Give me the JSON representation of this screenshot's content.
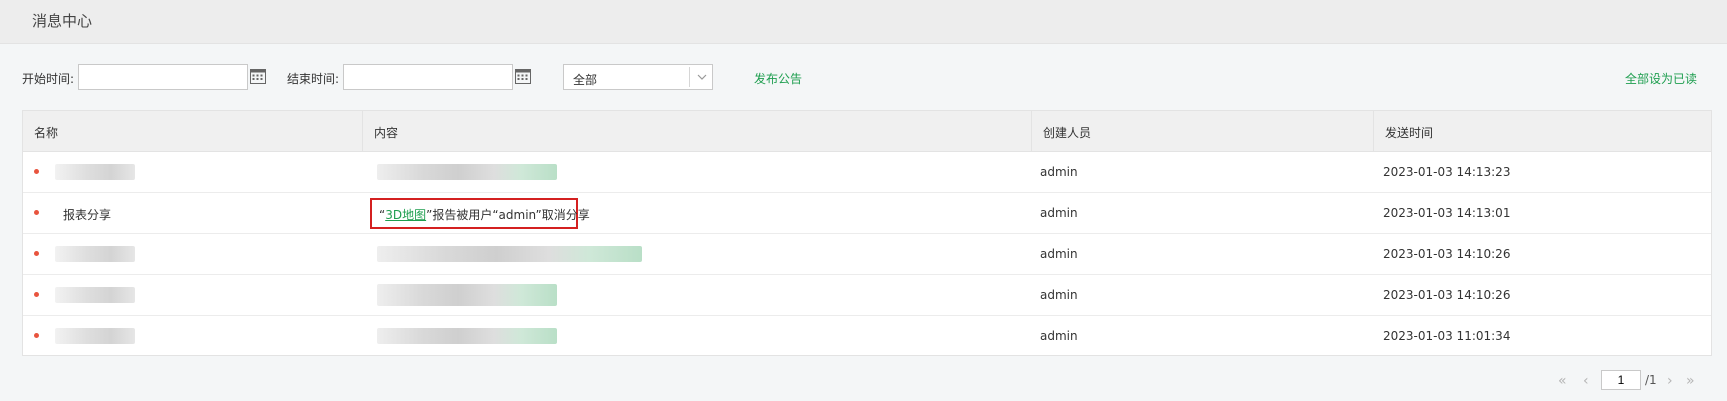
{
  "header": {
    "title": "消息中心"
  },
  "filters": {
    "start_label": "开始时间:",
    "end_label": "结束时间:",
    "start_value": "",
    "end_value": "",
    "type_select": "全部",
    "publish_label": "发布公告",
    "mark_all_read_label": "全部设为已读"
  },
  "table": {
    "columns": [
      "名称",
      "内容",
      "创建人员",
      "发送时间"
    ],
    "rows": [
      {
        "name": "",
        "content": "",
        "creator": "admin",
        "time": "2023-01-03 14:13:23"
      },
      {
        "name": "报表分享",
        "content_prefix": "“",
        "content_link": "3D地图",
        "content_suffix": "”报告被用户“admin”取消分享",
        "creator": "admin",
        "time": "2023-01-03 14:13:01"
      },
      {
        "name": "",
        "content": "",
        "creator": "admin",
        "time": "2023-01-03 14:10:26"
      },
      {
        "name": "",
        "content": "",
        "creator": "admin",
        "time": "2023-01-03 14:10:26"
      },
      {
        "name": "",
        "content": "",
        "creator": "admin",
        "time": "2023-01-03 11:01:34"
      }
    ]
  },
  "pagination": {
    "current_page": "1",
    "total_pages": "/1"
  },
  "colors": {
    "accent_green": "#1e9e4f",
    "unread_dot": "#e8543e",
    "highlight_border": "#d42020"
  }
}
